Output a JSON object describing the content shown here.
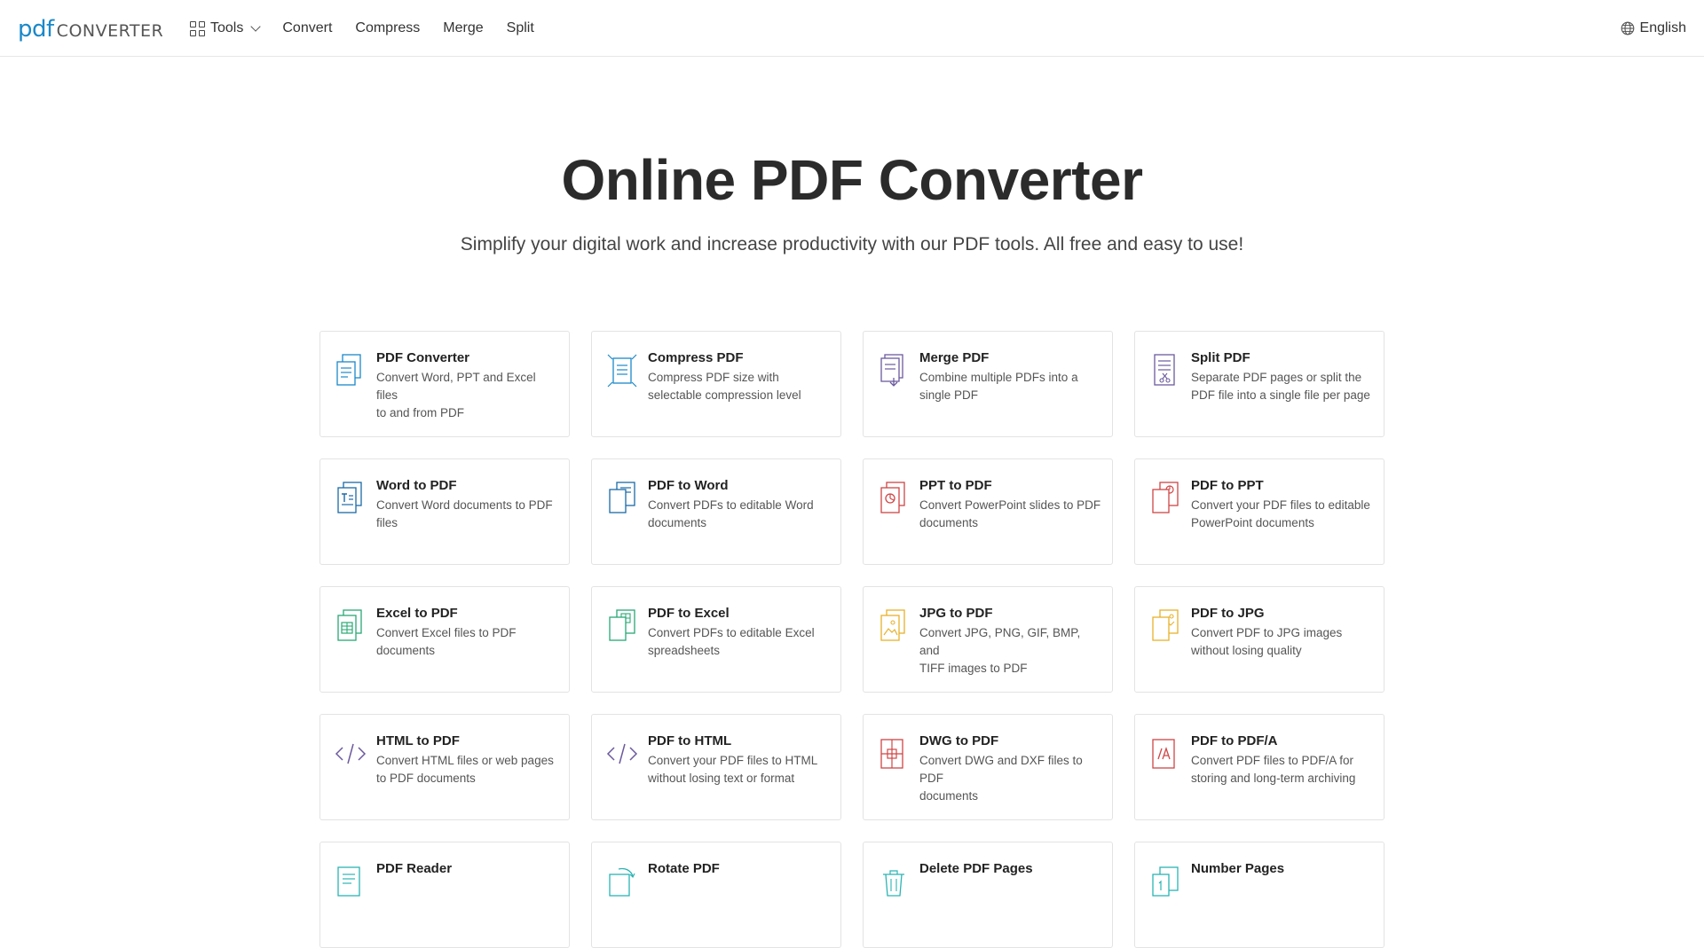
{
  "logo": {
    "pdf": "pdf",
    "converter": "CONVERTER"
  },
  "nav": {
    "tools": "Tools",
    "convert": "Convert",
    "compress": "Compress",
    "merge": "Merge",
    "split": "Split"
  },
  "language": "English",
  "hero": {
    "title": "Online PDF Converter",
    "subtitle": "Simplify your digital work and increase productivity with our PDF tools. All free and easy to use!"
  },
  "colors": {
    "blue": "#1a88c9",
    "purple": "#6b5a9e",
    "red": "#d04545",
    "green": "#2aa876",
    "yellow": "#e8b12a",
    "teal": "#2bb3b3"
  },
  "tools": [
    {
      "title": "PDF Converter",
      "desc1": "Convert Word, PPT and Excel files",
      "desc2": "to and from PDF",
      "icon": "pdf-converter-icon"
    },
    {
      "title": "Compress PDF",
      "desc1": "Compress PDF size with",
      "desc2": "selectable compression level",
      "icon": "compress-icon"
    },
    {
      "title": "Merge PDF",
      "desc1": "Combine multiple PDFs into a",
      "desc2": "single PDF",
      "icon": "merge-icon"
    },
    {
      "title": "Split PDF",
      "desc1": "Separate PDF pages or split the",
      "desc2": "PDF file into a single file per page",
      "icon": "split-icon"
    },
    {
      "title": "Word to PDF",
      "desc1": "Convert Word documents to PDF",
      "desc2": "files",
      "icon": "word-icon"
    },
    {
      "title": "PDF to Word",
      "desc1": "Convert PDFs to editable Word",
      "desc2": "documents",
      "icon": "word-doc-icon"
    },
    {
      "title": "PPT to PDF",
      "desc1": "Convert PowerPoint slides to PDF",
      "desc2": "documents",
      "icon": "ppt-icon"
    },
    {
      "title": "PDF to PPT",
      "desc1": "Convert your PDF files to editable",
      "desc2": "PowerPoint documents",
      "icon": "ppt-doc-icon"
    },
    {
      "title": "Excel to PDF",
      "desc1": "Convert Excel files to PDF",
      "desc2": "documents",
      "icon": "excel-icon"
    },
    {
      "title": "PDF to Excel",
      "desc1": "Convert PDFs to editable Excel",
      "desc2": "spreadsheets",
      "icon": "excel-doc-icon"
    },
    {
      "title": "JPG to PDF",
      "desc1": "Convert JPG, PNG, GIF, BMP, and",
      "desc2": "TIFF images to PDF",
      "icon": "image-icon"
    },
    {
      "title": "PDF to JPG",
      "desc1": "Convert PDF to JPG images",
      "desc2": "without losing quality",
      "icon": "image-doc-icon"
    },
    {
      "title": "HTML to PDF",
      "desc1": "Convert HTML files or web pages",
      "desc2": "to PDF documents",
      "icon": "code-icon"
    },
    {
      "title": "PDF to HTML",
      "desc1": "Convert your PDF files to HTML",
      "desc2": "without losing text or format",
      "icon": "code-icon"
    },
    {
      "title": "DWG to PDF",
      "desc1": "Convert DWG and DXF files to PDF",
      "desc2": "documents",
      "icon": "dwg-icon"
    },
    {
      "title": "PDF to PDF/A",
      "desc1": "Convert PDF files to PDF/A for",
      "desc2": "storing and long-term archiving",
      "icon": "pdfa-icon"
    },
    {
      "title": "PDF Reader",
      "desc1": "",
      "desc2": "",
      "icon": "reader-icon"
    },
    {
      "title": "Rotate PDF",
      "desc1": "",
      "desc2": "",
      "icon": "rotate-icon"
    },
    {
      "title": "Delete PDF Pages",
      "desc1": "",
      "desc2": "",
      "icon": "trash-icon"
    },
    {
      "title": "Number Pages",
      "desc1": "",
      "desc2": "",
      "icon": "number-pages-icon"
    }
  ]
}
